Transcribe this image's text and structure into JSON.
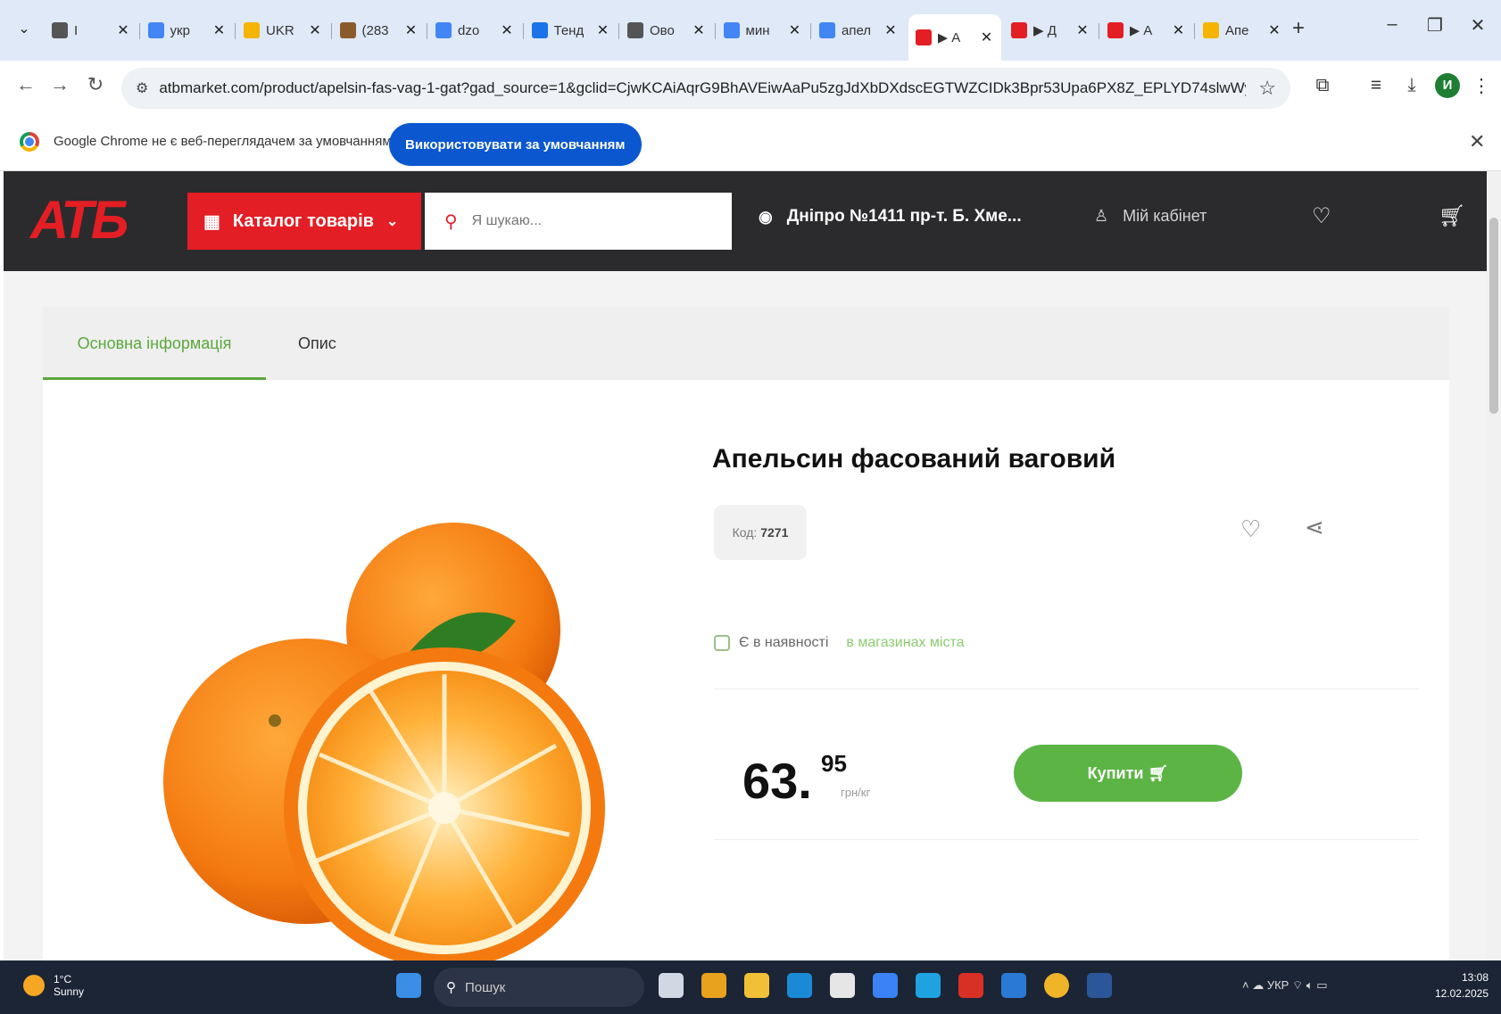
{
  "browser": {
    "tabs": [
      {
        "label": "I",
        "favicon_color": "#555555",
        "icon": "play-icon"
      },
      {
        "label": "укр",
        "favicon_color": "#4285f4",
        "icon": "google-icon"
      },
      {
        "label": "UKR",
        "favicon_color": "#f4b400",
        "icon": "mail-icon"
      },
      {
        "label": "(283",
        "favicon_color": "#8b5a2b",
        "icon": "image-icon"
      },
      {
        "label": "dzo",
        "favicon_color": "#4285f4",
        "icon": "google-icon"
      },
      {
        "label": "Тенд",
        "favicon_color": "#1a73e8",
        "icon": "site-icon"
      },
      {
        "label": "Ово",
        "favicon_color": "#555555",
        "icon": "eye-icon"
      },
      {
        "label": "мин",
        "favicon_color": "#4285f4",
        "icon": "google-icon"
      },
      {
        "label": "апел",
        "favicon_color": "#4285f4",
        "icon": "google-icon"
      },
      {
        "label": "▶ А",
        "favicon_color": "#e31e24",
        "icon": "atb-icon",
        "active": true
      },
      {
        "label": "▶ Д",
        "favicon_color": "#e31e24",
        "icon": "atb-icon"
      },
      {
        "label": "▶ А",
        "favicon_color": "#e31e24",
        "icon": "atb-icon"
      },
      {
        "label": "Апе",
        "favicon_color": "#f4b400",
        "icon": "site-icon"
      }
    ],
    "new_tab": "+",
    "url": "atbmarket.com/product/apelsin-fas-vag-1-gat?gad_source=1&gclid=CjwKCAiAqrG9BhAVEiwAaPu5zgJdXbDXdscEGTWZCIDk3Bpr53Upa6PX8Z_EPLYD74slwWyhd1vGxoCoiQQAvD_...",
    "profile_initial": "И",
    "infobar": {
      "message": "Google Chrome не є веб-переглядачем за умовчанням",
      "button": "Використовувати за умовчанням"
    }
  },
  "site": {
    "logo": "АТБ",
    "catalog_label": "Каталог товарів",
    "search_placeholder": "Я шукаю...",
    "location": "Дніпро №1411 пр-т. Б. Хме...",
    "cabinet": "Мій кабінет",
    "colors": {
      "brand_red": "#e31e24",
      "header_bg": "#2b2b2d",
      "accent_green": "#5cb445"
    }
  },
  "product": {
    "tabs": [
      "Основна інформація",
      "Опис"
    ],
    "title": "Апельсин фасований ваговий",
    "code_label": "Код:",
    "code_value": "7271",
    "stock_status": "Є в наявності",
    "stock_link": "в магазинах міста",
    "price_main": "63.",
    "price_cents": "95",
    "price_unit": "грн/кг",
    "buy_label": "Купити"
  },
  "taskbar": {
    "weather_temp": "1°C",
    "weather_desc": "Sunny",
    "search_placeholder": "Пошук",
    "tray_lang": "УКР",
    "time": "13:08",
    "date": "12.02.2025"
  }
}
